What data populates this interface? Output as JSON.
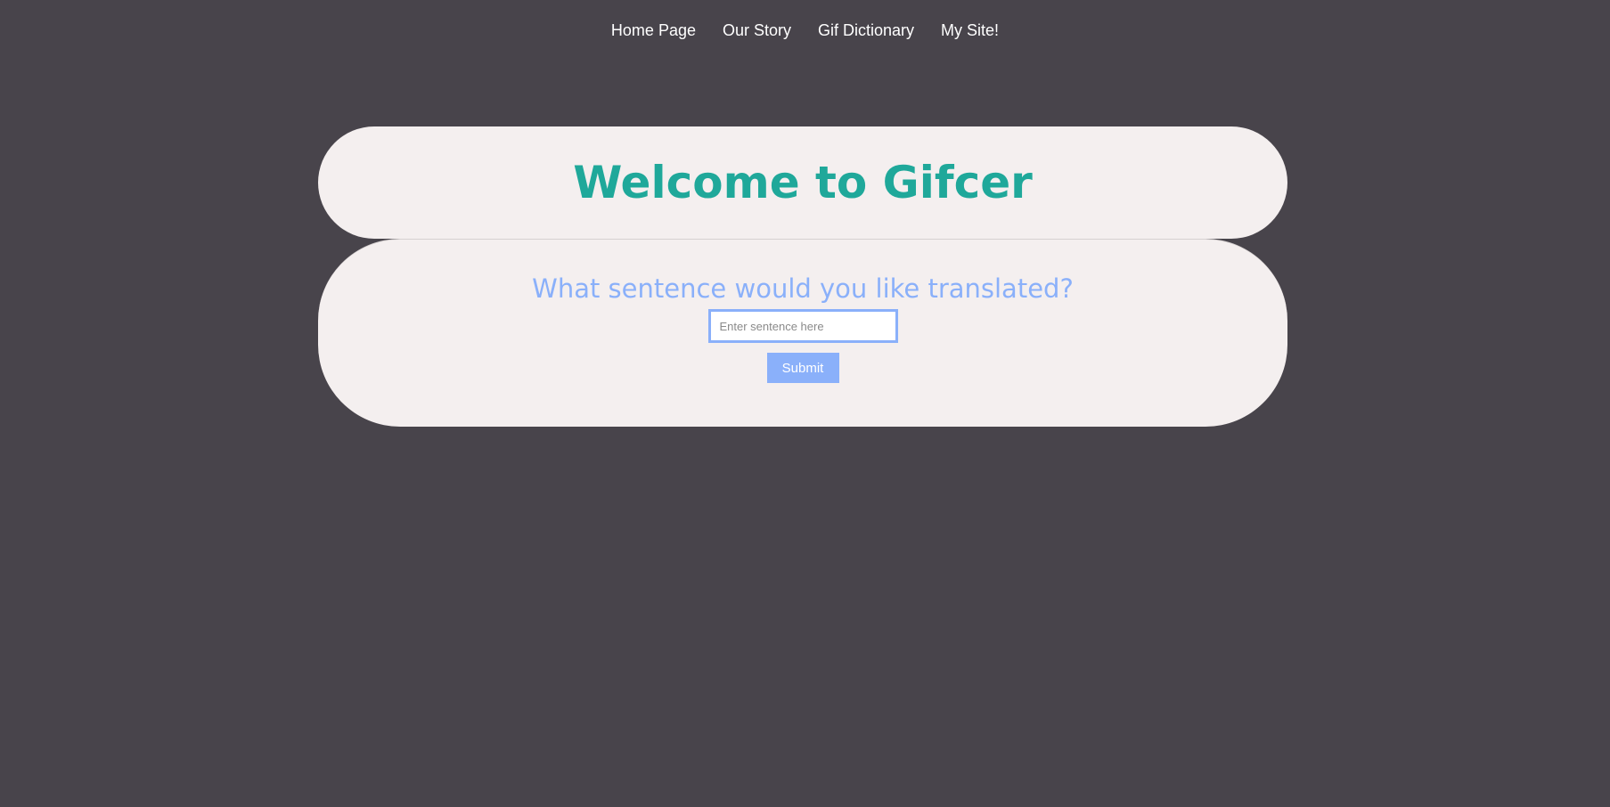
{
  "nav": {
    "items": [
      {
        "label": "Home Page"
      },
      {
        "label": "Our Story"
      },
      {
        "label": "Gif Dictionary"
      },
      {
        "label": "My Site!"
      }
    ]
  },
  "hero": {
    "title": "Welcome to Gifcer"
  },
  "form": {
    "prompt": "What sentence would you like translated?",
    "input_value": "",
    "input_placeholder": "Enter sentence here",
    "submit_label": "Submit"
  },
  "colors": {
    "background": "#48444b",
    "card": "#f4efef",
    "title": "#1fa89a",
    "accent": "#8ab0fa"
  }
}
